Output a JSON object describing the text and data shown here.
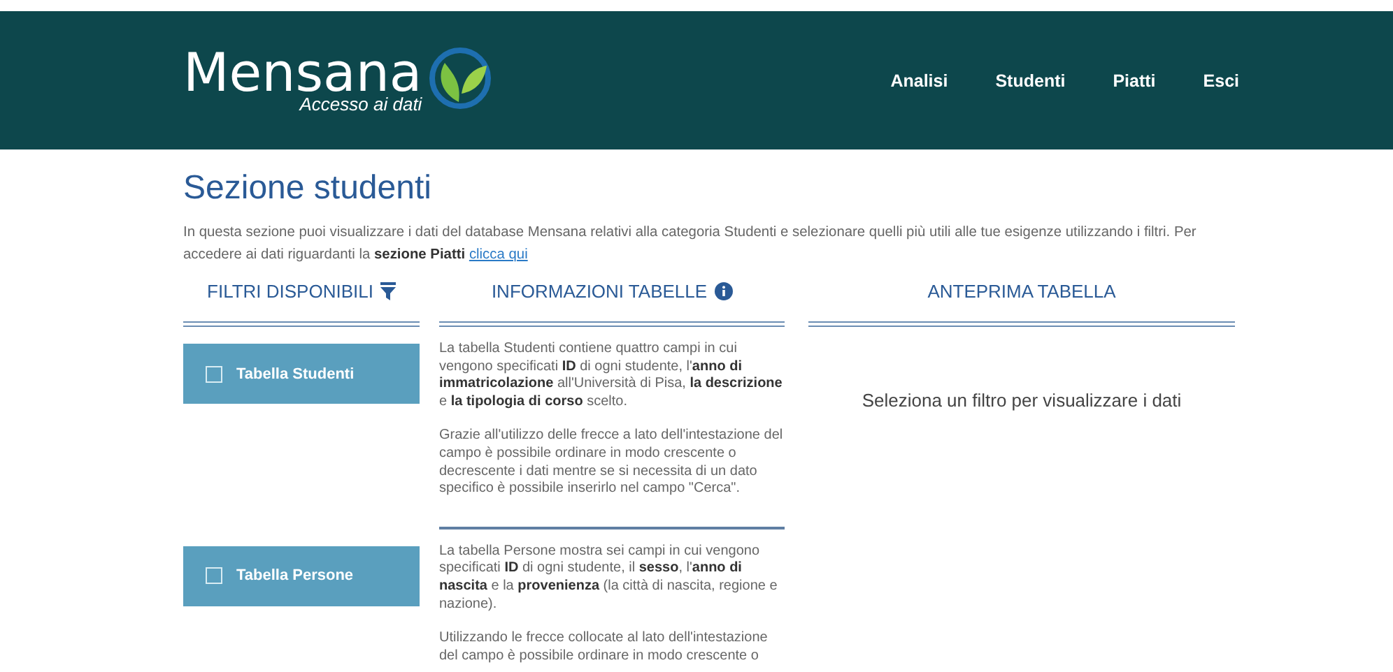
{
  "header": {
    "logo": {
      "name": "Mensana",
      "tagline": "Accesso ai dati"
    },
    "nav": [
      {
        "label": "Analisi"
      },
      {
        "label": "Studenti"
      },
      {
        "label": "Piatti"
      },
      {
        "label": "Esci"
      }
    ]
  },
  "page": {
    "title": "Sezione studenti",
    "intro": "In questa sezione puoi visualizzare i dati del database Mensana relativi alla categoria Studenti e selezionare quelli più utili alle tue esigenze utilizzando i filtri. Per accedere ai dati riguardanti la **sezione Piatti**",
    "intro_link": "clicca qui"
  },
  "columns": [
    {
      "heading": "FILTRI DISPONIBILI"
    },
    {
      "heading": "INFORMAZIONI TABELLE"
    },
    {
      "heading": "ANTEPRIMA TABELLA"
    }
  ],
  "filters": [
    {
      "label": "Tabella Studenti",
      "checked": false,
      "info": [
        "La tabella Studenti contiene quattro campi in cui vengono specificati **ID** di ogni studente, l'**anno di immatricolazione** all'Università di Pisa, **la descrizione** e **la tipologia di corso** scelto.",
        "Grazie all'utilizzo delle frecce a lato dell'intestazione del campo è possibile ordinare in modo crescente o decrescente i dati mentre se si necessita di un dato specifico è possibile inserirlo nel campo \"Cerca\"."
      ]
    },
    {
      "label": "Tabella Persone",
      "checked": false,
      "info": [
        "La tabella Persone mostra sei campi in cui vengono specificati **ID** di ogni studente, il **sesso**, l'**anno di nascita** e la **provenienza** (la città di nascita, regione e nazione).",
        "Utilizzando le frecce collocate al lato dell'intestazione del campo è possibile ordinare in modo crescente o"
      ]
    }
  ],
  "preview": {
    "message": "Seleziona un filtro per visualizzare i dati"
  }
}
